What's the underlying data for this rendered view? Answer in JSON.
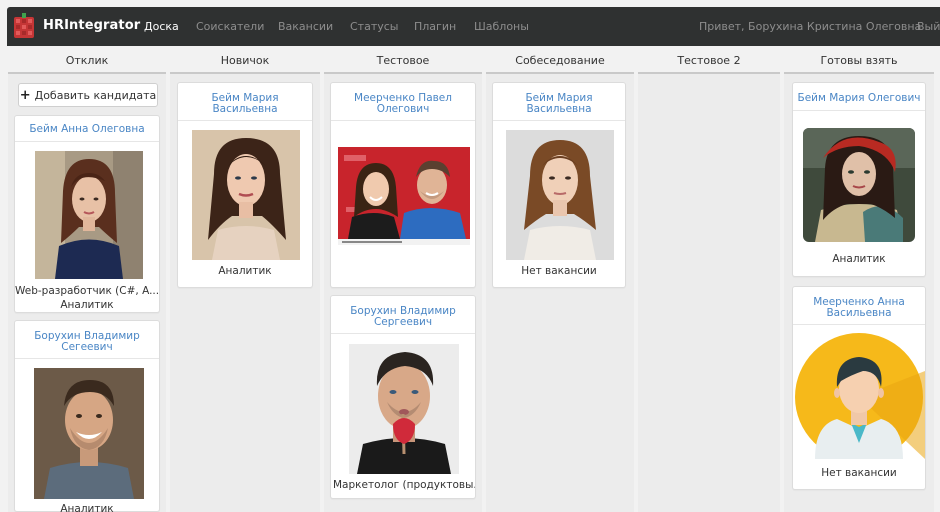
{
  "app": {
    "brand": "HRIntegrator",
    "nav": [
      "Доска",
      "Соискатели",
      "Вакансии",
      "Статусы",
      "Плагин",
      "Шаблоны"
    ],
    "greeting": "Привет, Борухина Кристина Олеговна",
    "logout": "Вый"
  },
  "columns": [
    "Отклик",
    "Новичок",
    "Тестовое",
    "Собеседование",
    "Тестовое 2",
    "Готовы взять"
  ],
  "add_candidate": "Добавить кандидата",
  "cards": {
    "c1": {
      "name": "Бейм Анна Олеговна",
      "position": "Web-разработчик (C#, A...",
      "vacancy": "Аналитик"
    },
    "c2": {
      "name": "Борухин Владимир Сегеевич",
      "vacancy": "Аналитик"
    },
    "c3": {
      "name": "Бейм Мария Васильевна",
      "vacancy": "Аналитик"
    },
    "c4": {
      "name": "Меерченко Павел Олегович"
    },
    "c5": {
      "name": "Борухин Владимир Сергеевич",
      "vacancy": "Маркетолог (продуктовы..."
    },
    "c6": {
      "name": "Бейм Мария Васильевна",
      "vacancy": "Нет вакансии"
    },
    "c7": {
      "name": "Бейм Мария Олегович",
      "vacancy": "Аналитик"
    },
    "c8": {
      "name": "Меерченко Анна Васильевна",
      "vacancy": "Нет вакансии"
    }
  },
  "colors": {
    "navbar": "#2f3131",
    "link": "#4a86c5",
    "board": "#ececec"
  }
}
